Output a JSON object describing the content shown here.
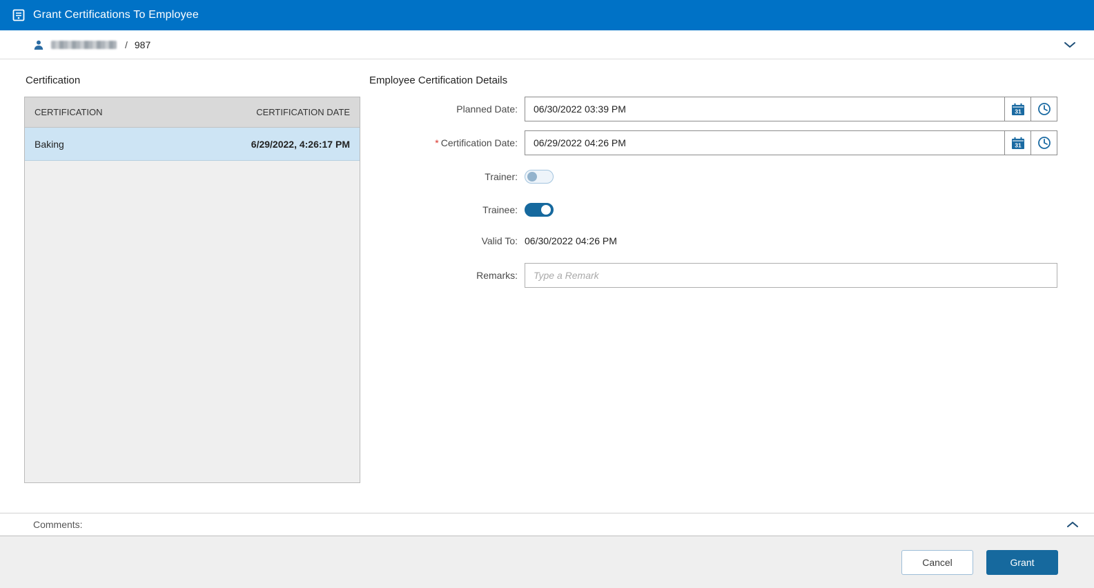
{
  "colors": {
    "header_bg": "#0072C6",
    "accent_blue": "#16699E",
    "selected_row_bg": "#CDE4F4",
    "table_header_bg": "#D9D9D9",
    "required_marker": "#D9342B"
  },
  "header": {
    "title": "Grant Certifications To Employee"
  },
  "subheader": {
    "separator": "/",
    "employee_id": "987"
  },
  "certification_panel": {
    "title": "Certification",
    "columns": [
      "CERTIFICATION",
      "CERTIFICATION DATE"
    ],
    "rows": [
      {
        "certification": "Baking",
        "certification_date": "6/29/2022, 4:26:17 PM"
      }
    ]
  },
  "details_panel": {
    "title": "Employee Certification Details",
    "planned_date": {
      "label": "Planned Date:",
      "value": "06/30/2022 03:39 PM"
    },
    "certification_date": {
      "label": "Certification Date:",
      "required_marker": "*",
      "value": "06/29/2022 04:26 PM"
    },
    "trainer": {
      "label": "Trainer:",
      "state": "off"
    },
    "trainee": {
      "label": "Trainee:",
      "state": "on"
    },
    "valid_to": {
      "label": "Valid To:",
      "value": "06/30/2022 04:26 PM"
    },
    "remarks": {
      "label": "Remarks:",
      "placeholder": "Type a Remark",
      "value": ""
    }
  },
  "comments": {
    "label": "Comments:"
  },
  "footer": {
    "cancel_label": "Cancel",
    "grant_label": "Grant"
  },
  "icons": {
    "app": "certificate-icon",
    "employee": "person-icon",
    "header_collapse": "chevron-down-icon",
    "comments_collapse": "chevron-up-icon",
    "date_picker": "calendar-icon",
    "time_picker": "clock-icon"
  }
}
